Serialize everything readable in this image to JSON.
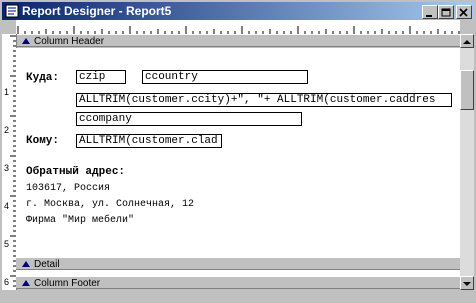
{
  "window": {
    "title": "Report Designer - Report5"
  },
  "bands": {
    "column_header": "Column Header",
    "detail": "Detail",
    "column_footer": "Column Footer"
  },
  "vertical_ruler": [
    "1",
    "2",
    "3",
    "4",
    "5",
    "6"
  ],
  "report": {
    "to_label": "Куда:",
    "czip": "czip",
    "ccountry": "ccountry",
    "city_expr": "ALLTRIM(customer.ccity)+\", \"+ ALLTRIM(customer.caddres",
    "ccompany": "ccompany",
    "whom_label": "Кому:",
    "clad_expr": "ALLTRIM(customer.clad",
    "return_title": "Обратный адрес:",
    "return_line1": "103617, Россия",
    "return_line2": "г. Москва, ул. Солнечная, 12",
    "return_line3": "Фирма \"Мир мебели\""
  },
  "colors": {
    "title_start": "#08246b",
    "title_end": "#a6caf0",
    "band_marker": "#000080"
  }
}
